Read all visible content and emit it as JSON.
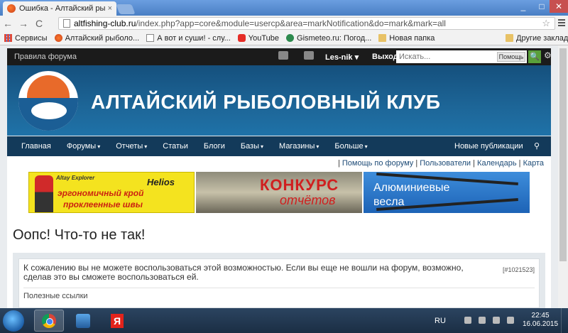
{
  "browser": {
    "tab_title": "Ошибка - Алтайский рыб",
    "tab_close": "×",
    "window_min": "_",
    "window_max": "□",
    "window_close": "✕",
    "url_domain": "altfishing-club.ru",
    "url_path": "/index.php?app=core&module=usercp&area=markNotification&do=mark&mark=all",
    "back": "←",
    "forward": "→",
    "reload": "C",
    "star": "☆"
  },
  "bookmarks": {
    "items": [
      {
        "label": "Сервисы",
        "icon": "apps-icon"
      },
      {
        "label": "Алтайский рыболо...",
        "icon": "fish-icon"
      },
      {
        "label": "А вот и суши! - слу...",
        "icon": "page-icon"
      },
      {
        "label": "YouTube",
        "icon": "youtube-icon"
      },
      {
        "label": "Gismeteo.ru: Погод...",
        "icon": "gismeteo-icon"
      },
      {
        "label": "Новая папка",
        "icon": "folder-icon"
      }
    ],
    "other": "Другие закладки"
  },
  "site": {
    "rules": "Правила форума",
    "username": "Les-nik",
    "caret": "▾",
    "logout": "Выход",
    "search_placeholder": "Искать...",
    "search_button": "Помощь",
    "search_go": "🔍",
    "gear": "⚙",
    "title": "АЛТАЙСКИЙ РЫБОЛОВНЫЙ КЛУБ",
    "nav": [
      {
        "label": "Главная",
        "dropdown": false
      },
      {
        "label": "Форумы",
        "dropdown": true
      },
      {
        "label": "Отчеты",
        "dropdown": true
      },
      {
        "label": "Статьи",
        "dropdown": false
      },
      {
        "label": "Блоги",
        "dropdown": false
      },
      {
        "label": "Базы",
        "dropdown": true
      },
      {
        "label": "Магазины",
        "dropdown": true
      },
      {
        "label": "Больше",
        "dropdown": true
      }
    ],
    "nav_new": "Новые публикации",
    "nav_pin": "⚲",
    "help_links": [
      "Помощь по форуму",
      "Пользователи",
      "Календарь",
      "Карта"
    ]
  },
  "ads": {
    "ad1": {
      "small": "Altay Explorer",
      "brand": "Helios",
      "line1": "эргономичный крой",
      "line2": "проклеенные швы"
    },
    "ad2": {
      "line1": "КОНКУРС",
      "line2": "отчётов"
    },
    "ad3": {
      "line1": "Алюминиевые",
      "line2": "весла"
    }
  },
  "error": {
    "title": "Оопс! Что-то не так!",
    "message": "К сожалению вы не можете воспользоваться этой возможностью. Если вы еще не вошли на форум, возможно, сделав это вы сможете воспользоваться ей.",
    "code": "[#1021523]",
    "useful_links": "Полезные ссылки"
  },
  "taskbar": {
    "language": "RU",
    "time": "22:45",
    "date": "16.06.2015",
    "yandex": "Я"
  }
}
